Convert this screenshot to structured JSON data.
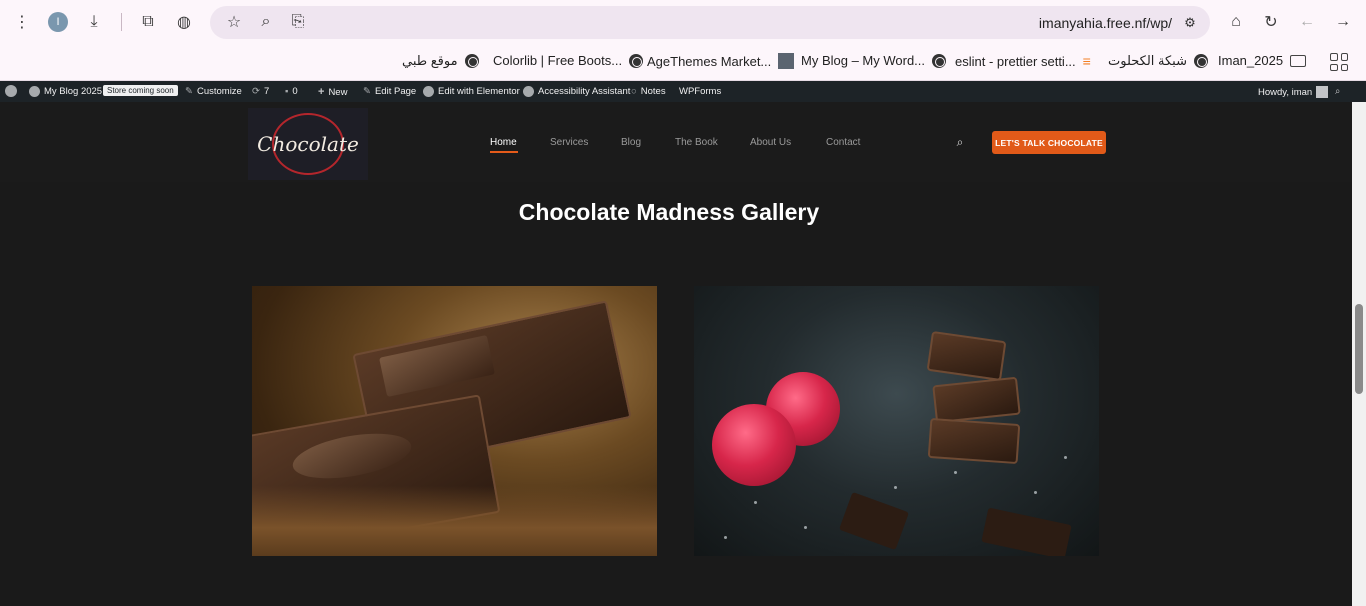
{
  "browser": {
    "url": "imanyahia.free.nf/wp/",
    "profile_initial": "I"
  },
  "bookmarks": [
    {
      "label": "موقع طبي",
      "icon": "globe-icon"
    },
    {
      "label": "Colorlib | Free Boots...",
      "icon": "globe-icon"
    },
    {
      "label": "AgeThemes Market...",
      "icon": "agethemes-icon"
    },
    {
      "label": "My Blog – My Word...",
      "icon": "globe-icon"
    },
    {
      "label": "eslint - prettier setti...",
      "icon": "stackoverflow-icon"
    },
    {
      "label": "شبكة الكحلوت",
      "icon": "globe-icon"
    },
    {
      "label": "Iman_2025",
      "icon": "folder-icon"
    }
  ],
  "wp_admin_bar": {
    "site_name": "My Blog 2025",
    "store_badge": "Store coming soon",
    "customize": "Customize",
    "updates_count": "7",
    "comments_count": "0",
    "new": "New",
    "edit_page": "Edit Page",
    "edit_elementor": "Edit with Elementor",
    "accessibility": "Accessibility Assistant",
    "notes": "Notes",
    "wpforms": "WPForms",
    "howdy": "Howdy, iman"
  },
  "site": {
    "logo_text": "Chocolate",
    "nav": [
      {
        "label": "Home",
        "active": true
      },
      {
        "label": "Services",
        "active": false
      },
      {
        "label": "Blog",
        "active": false
      },
      {
        "label": "The Book",
        "active": false
      },
      {
        "label": "About Us",
        "active": false
      },
      {
        "label": "Contact",
        "active": false
      }
    ],
    "cta": "LET'S TALK CHOCOLATE",
    "accent_color": "#e15a19"
  },
  "gallery": {
    "title": "Chocolate Madness Gallery",
    "photos": [
      {
        "description": "chocolate bars on cocoa powder"
      },
      {
        "description": "chocolate pieces with raspberries"
      }
    ]
  }
}
